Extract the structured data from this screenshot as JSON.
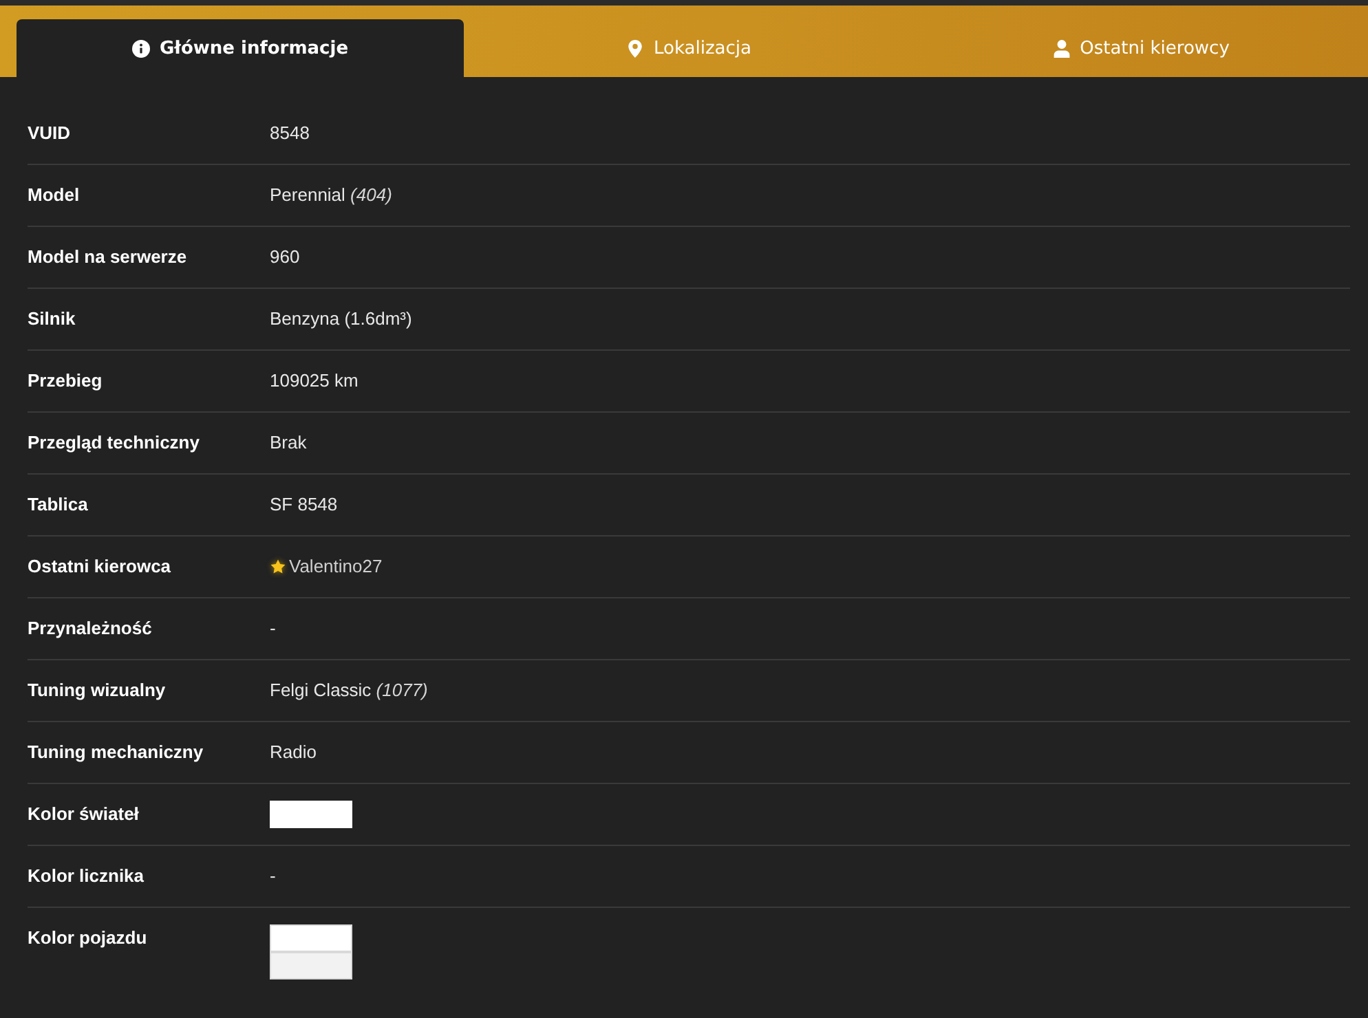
{
  "tabs": [
    {
      "label": "Główne informacje",
      "selected": true
    },
    {
      "label": "Lokalizacja",
      "selected": false
    },
    {
      "label": "Ostatni kierowcy",
      "selected": false
    }
  ],
  "rows": [
    {
      "label": "VUID",
      "kind": "text",
      "value": "8548"
    },
    {
      "label": "Model",
      "kind": "text",
      "value": "Perennial *(404)*"
    },
    {
      "label": "Model na serwerze",
      "kind": "text",
      "value": "960"
    },
    {
      "label": "Silnik",
      "kind": "text",
      "value": "Benzyna (1.6dm³)"
    },
    {
      "label": "Przebieg",
      "kind": "text",
      "value": "109025 km"
    },
    {
      "label": "Przegląd techniczny",
      "kind": "text",
      "value": "Brak"
    },
    {
      "label": "Tablica",
      "kind": "text",
      "value": "SF 8548"
    },
    {
      "label": "Ostatni kierowca",
      "kind": "driver",
      "value": "Valentino27",
      "starred": true
    },
    {
      "label": "Przynależność",
      "kind": "text",
      "value": "-"
    },
    {
      "label": "Tuning wizualny",
      "kind": "text",
      "value": "Felgi Classic *(1077)*"
    },
    {
      "label": "Tuning mechaniczny",
      "kind": "text",
      "value": "Radio"
    },
    {
      "label": "Kolor świateł",
      "kind": "colors",
      "colors": [
        {
          "color": "#ffffff"
        }
      ]
    },
    {
      "label": "Kolor licznika",
      "kind": "text",
      "value": "-"
    },
    {
      "label": "Kolor pojazdu",
      "kind": "colors",
      "colors": [
        {
          "color": "#ffffff"
        },
        {
          "color": "#f2f2f2"
        }
      ]
    }
  ]
}
